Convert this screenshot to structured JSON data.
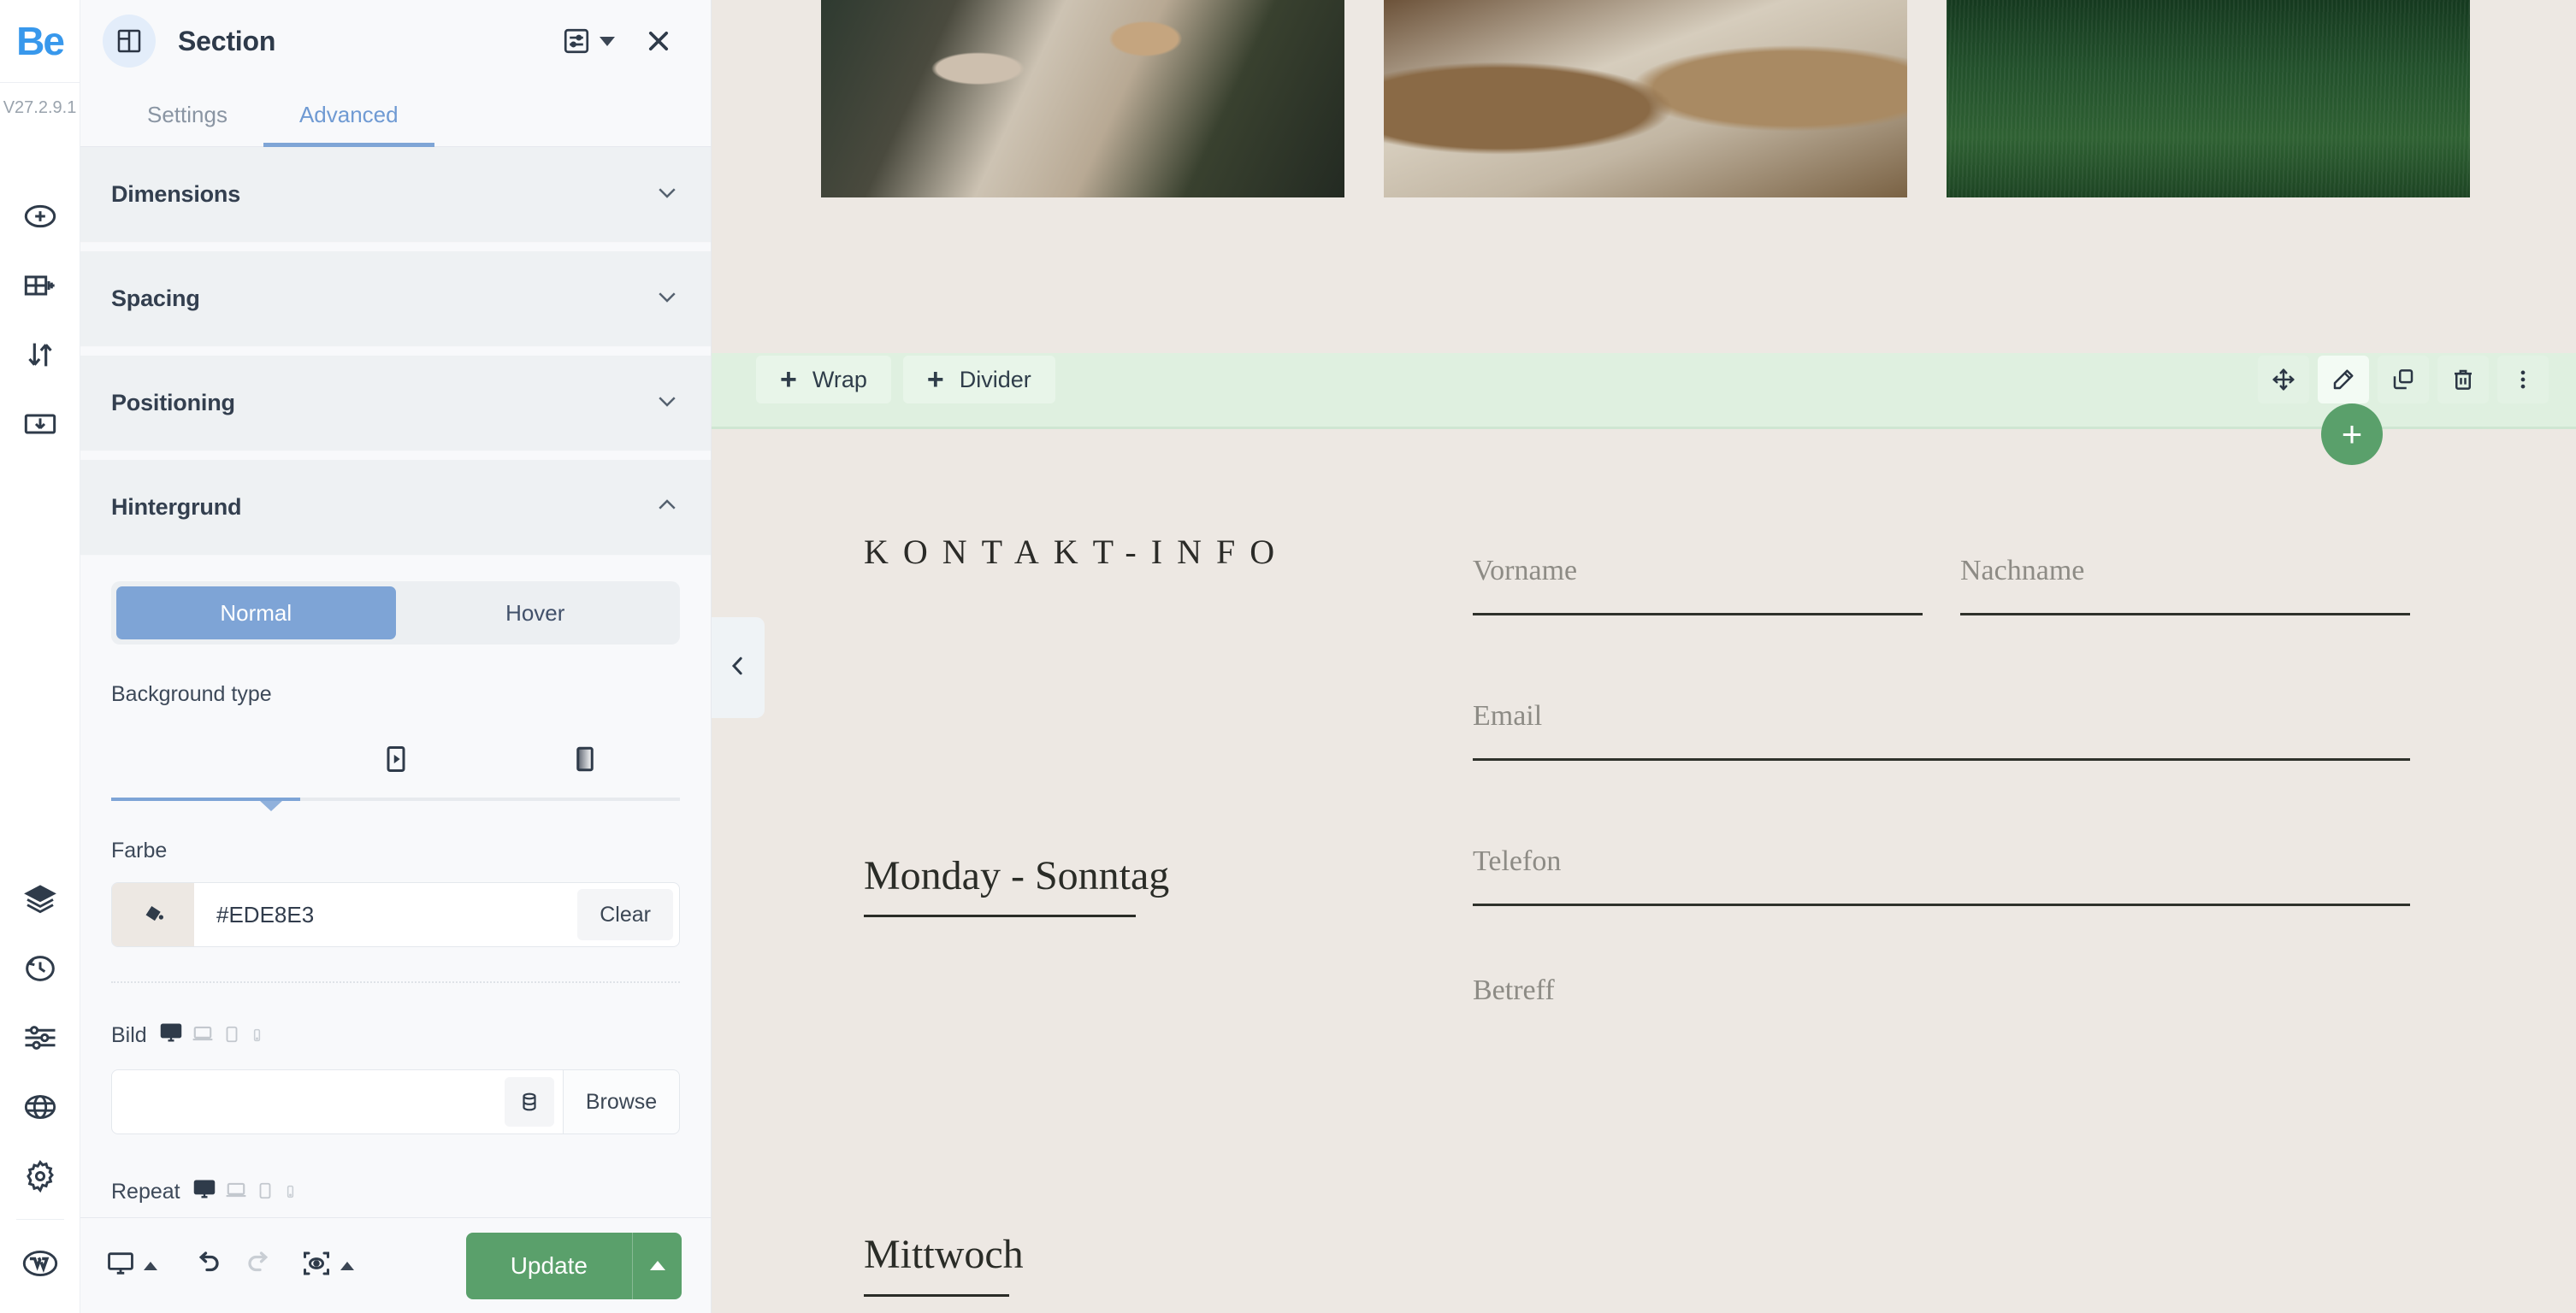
{
  "rail": {
    "logo_text": "Be",
    "version": "V27.2.9.1",
    "items_top": [
      {
        "name": "add-element",
        "icon": "circle-plus-icon"
      },
      {
        "name": "add-section",
        "icon": "section-plus-icon"
      },
      {
        "name": "reorder",
        "icon": "arrows-up-down-icon"
      },
      {
        "name": "insert-template",
        "icon": "template-insert-icon"
      }
    ],
    "items_bottom": [
      {
        "name": "layers",
        "icon": "layers-icon"
      },
      {
        "name": "history",
        "icon": "history-clock-icon"
      },
      {
        "name": "global-settings",
        "icon": "sliders-icon"
      },
      {
        "name": "website-settings",
        "icon": "globe-icon"
      },
      {
        "name": "preferences",
        "icon": "gear-icon"
      },
      {
        "name": "wordpress",
        "icon": "wordpress-icon"
      }
    ]
  },
  "panel": {
    "title": "Section",
    "header_icon": "section-layout-icon",
    "header_actions": [
      {
        "name": "element-settings-icon",
        "label": "element-settings"
      },
      {
        "name": "chevron-down-icon",
        "label": "more"
      },
      {
        "name": "close-icon",
        "label": "close"
      }
    ],
    "tabs": [
      {
        "label": "Settings",
        "active": false
      },
      {
        "label": "Advanced",
        "active": true
      }
    ],
    "accordions": [
      {
        "label": "Dimensions",
        "open": false
      },
      {
        "label": "Spacing",
        "open": false
      },
      {
        "label": "Positioning",
        "open": false
      },
      {
        "label": "Hintergrund",
        "open": true
      }
    ],
    "state_toggle": {
      "options": [
        "Normal",
        "Hover"
      ],
      "selected": "Normal"
    },
    "background_type": {
      "label": "Background type",
      "options": [
        "color",
        "video",
        "gradient"
      ],
      "selected_index": 0
    },
    "color": {
      "label": "Farbe",
      "value": "#EDE8E3",
      "clear_label": "Clear",
      "swatch_icon": "paint-bucket-icon",
      "swatch_color": "#EDE8E3"
    },
    "image": {
      "label": "Bild",
      "value": "",
      "browse_label": "Browse",
      "dynamic_icon": "database-icon",
      "breakpoints": [
        "desktop",
        "laptop",
        "tablet",
        "phone"
      ],
      "active_breakpoint": "desktop"
    },
    "repeat": {
      "label": "Repeat",
      "breakpoints": [
        "desktop",
        "laptop",
        "tablet",
        "phone"
      ],
      "active_breakpoint": "desktop"
    },
    "footer": {
      "viewport_icon": "desktop-icon",
      "undo_icon": "undo-icon",
      "redo_icon": "redo-icon",
      "redo_disabled": true,
      "preview_icon": "preview-eye-icon",
      "update_label": "Update",
      "update_color": "#5AA06B"
    }
  },
  "canvas": {
    "gallery": [
      {
        "name": "image-rolling-pin-flour",
        "alt": "rolling pin with flour"
      },
      {
        "name": "image-baking-hands",
        "alt": "baking scene"
      },
      {
        "name": "image-green-field",
        "alt": "green grass field"
      }
    ],
    "section_toolbar": {
      "left_buttons": [
        {
          "label": "Wrap",
          "icon": "plus-icon"
        },
        {
          "label": "Divider",
          "icon": "plus-icon"
        }
      ],
      "right_icons": [
        {
          "name": "move-icon",
          "selected": false
        },
        {
          "name": "edit-pencil-icon",
          "selected": true
        },
        {
          "name": "duplicate-icon",
          "selected": false
        },
        {
          "name": "trash-icon",
          "selected": false
        },
        {
          "name": "more-vertical-icon",
          "selected": false
        }
      ],
      "add_button_icon": "plus-icon",
      "accent_color": "#5AA06B",
      "band_color": "#DFF0E0"
    },
    "collapse_handle_icon": "chevron-left-icon",
    "background_color": "#EDE8E3",
    "content": {
      "heading": "KONTAKT-INFO",
      "days": [
        {
          "text": "Monday - Sonntag"
        },
        {
          "text": "Mittwoch"
        }
      ],
      "form": {
        "first_name_placeholder": "Vorname",
        "last_name_placeholder": "Nachname",
        "email_placeholder": "Email",
        "phone_placeholder": "Telefon",
        "subject_placeholder": "Betreff",
        "first_name_value": "",
        "last_name_value": "",
        "email_value": "",
        "phone_value": "",
        "subject_value": ""
      }
    }
  }
}
